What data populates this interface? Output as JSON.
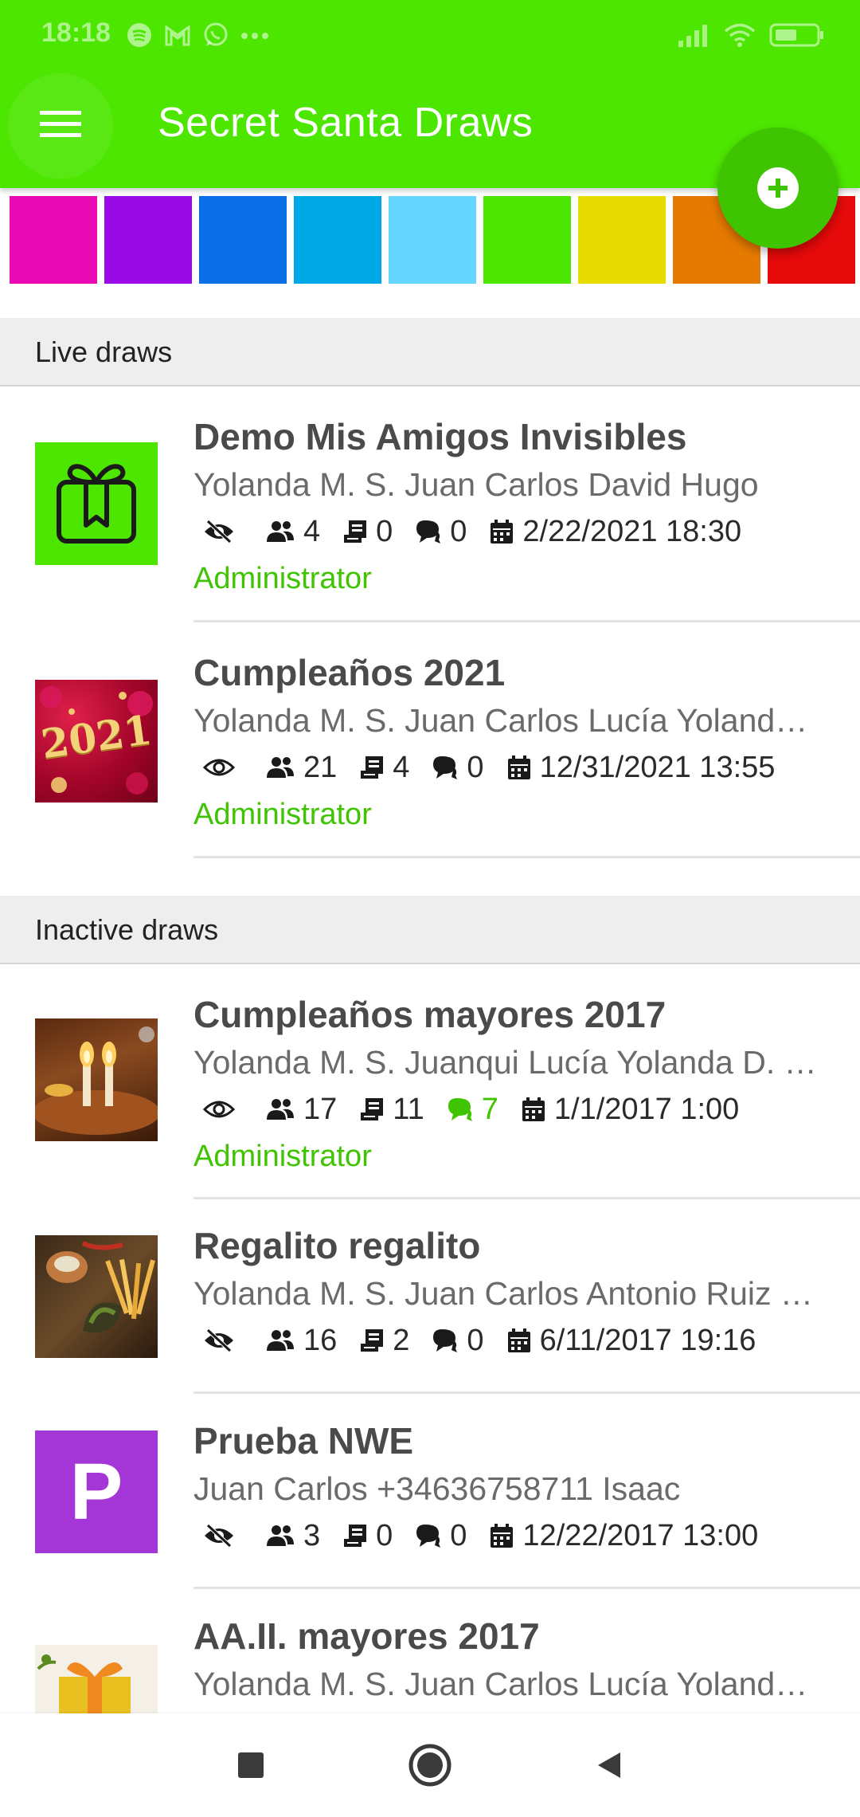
{
  "status_bar": {
    "time": "18:18",
    "left_icons": [
      "spotify-icon",
      "gmail-icon",
      "whatsapp-icon",
      "more-dots-icon"
    ],
    "right_icons": [
      "signal-icon",
      "wifi-icon",
      "battery-icon"
    ]
  },
  "app_bar": {
    "title": "Secret Santa Draws",
    "menu_icon": "hamburger-menu-icon",
    "fab_icon": "add-icon"
  },
  "colors": {
    "accent": "#4de600",
    "accent_dark": "#3ec400"
  },
  "swatches": [
    "#e90ab3",
    "#9a0ae6",
    "#0a6ee6",
    "#00a9e6",
    "#66d6ff",
    "#4de600",
    "#e6dc00",
    "#e67a00",
    "#e60a0a"
  ],
  "sections": {
    "live": {
      "label": "Live draws",
      "items": [
        {
          "title": "Demo Mis Amigos Invisibles",
          "members": "Yolanda M. S. Juan Carlos David Hugo",
          "visibility_icon": "eye-off-icon",
          "participants": "4",
          "documents": "0",
          "messages": "0",
          "date": "2/22/2021 18:30",
          "role": "Administrator",
          "thumbnail": "gift-icon"
        },
        {
          "title": "Cumpleaños 2021",
          "members": "Yolanda M. S. Juan Carlos Lucía Yolanda D. Juanqui",
          "visibility_icon": "eye-icon",
          "participants": "21",
          "documents": "4",
          "messages": "0",
          "date": "12/31/2021 13:55",
          "role": "Administrator",
          "thumbnail": "photo",
          "thumbnail_text": "2021"
        }
      ]
    },
    "inactive": {
      "label": "Inactive draws",
      "items": [
        {
          "title": "Cumpleaños mayores 2017",
          "members": "Yolanda M. S. Juanqui Lucía Yolanda D. Juan Carlos",
          "visibility_icon": "eye-icon",
          "participants": "17",
          "documents": "11",
          "messages": "7",
          "messages_highlight": true,
          "date": "1/1/2017 1:00",
          "role": "Administrator",
          "thumbnail": "photo"
        },
        {
          "title": "Regalito regalito",
          "members": "Yolanda M. S. Juan Carlos Antonio Ruiz García",
          "visibility_icon": "eye-off-icon",
          "participants": "16",
          "documents": "2",
          "messages": "0",
          "date": "6/11/2017 19:16",
          "thumbnail": "photo"
        },
        {
          "title": "Prueba NWE",
          "members": "Juan Carlos +34636758711 Isaac",
          "visibility_icon": "eye-off-icon",
          "participants": "3",
          "documents": "0",
          "messages": "0",
          "date": "12/22/2017 13:00",
          "thumbnail": "letter",
          "thumbnail_text": "P"
        },
        {
          "title": "AA.II. mayores 2017",
          "members": "Yolanda M. S. Juan Carlos Lucía Yolanda D. Juanqui",
          "thumbnail": "photo"
        }
      ]
    }
  },
  "nav_bar": {
    "icons": [
      "recents-square-icon",
      "home-circle-icon",
      "back-triangle-icon"
    ]
  }
}
